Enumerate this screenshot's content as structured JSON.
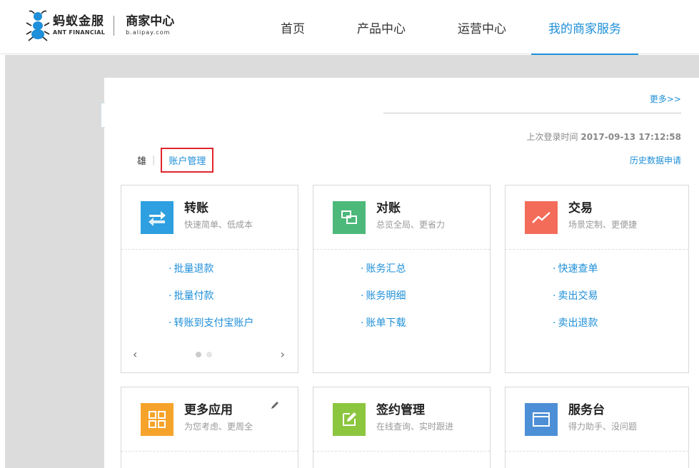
{
  "header": {
    "logo_cn": "蚂蚁金服",
    "logo_en": "ANT FINANCIAL",
    "brand_cn": "商家中心",
    "brand_en": "b.alipay.com",
    "nav": [
      "首页",
      "产品中心",
      "运营中心",
      "我的商家服务"
    ]
  },
  "panel": {
    "more_link": "更多>>",
    "last_login_label": "上次登录时间",
    "last_login_time": "2017-09-13 17:12:58",
    "user_name": "雄",
    "separator": "|",
    "account_mgmt": "账户管理",
    "history_link": "历史数据申请"
  },
  "cards": [
    {
      "title": "转账",
      "subtitle": "快速简单、低成本",
      "icon": "transfer-icon",
      "color": "#2e9fe0",
      "links": [
        "批量退款",
        "批量付款",
        "转账到支付宝账户"
      ]
    },
    {
      "title": "对账",
      "subtitle": "总览全局、更省力",
      "icon": "reconcile-icon",
      "color": "#4cb87a",
      "links": [
        "账务汇总",
        "账务明细",
        "账单下载"
      ]
    },
    {
      "title": "交易",
      "subtitle": "场景定制、更便捷",
      "icon": "trade-chart-icon",
      "color": "#f36c5a",
      "links": [
        "快速查单",
        "卖出交易",
        "卖出退款"
      ]
    },
    {
      "title": "更多应用",
      "subtitle": "为您考虑、更周全",
      "icon": "apps-grid-icon",
      "color": "#f6a32b"
    },
    {
      "title": "签约管理",
      "subtitle": "在线查询、实时跟进",
      "icon": "contract-edit-icon",
      "color": "#8cc63f"
    },
    {
      "title": "服务台",
      "subtitle": "得力助手、没问题",
      "icon": "service-window-icon",
      "color": "#4d8fd6"
    }
  ],
  "pager": {
    "prev": "‹",
    "next": "›"
  },
  "link_dot": "·"
}
